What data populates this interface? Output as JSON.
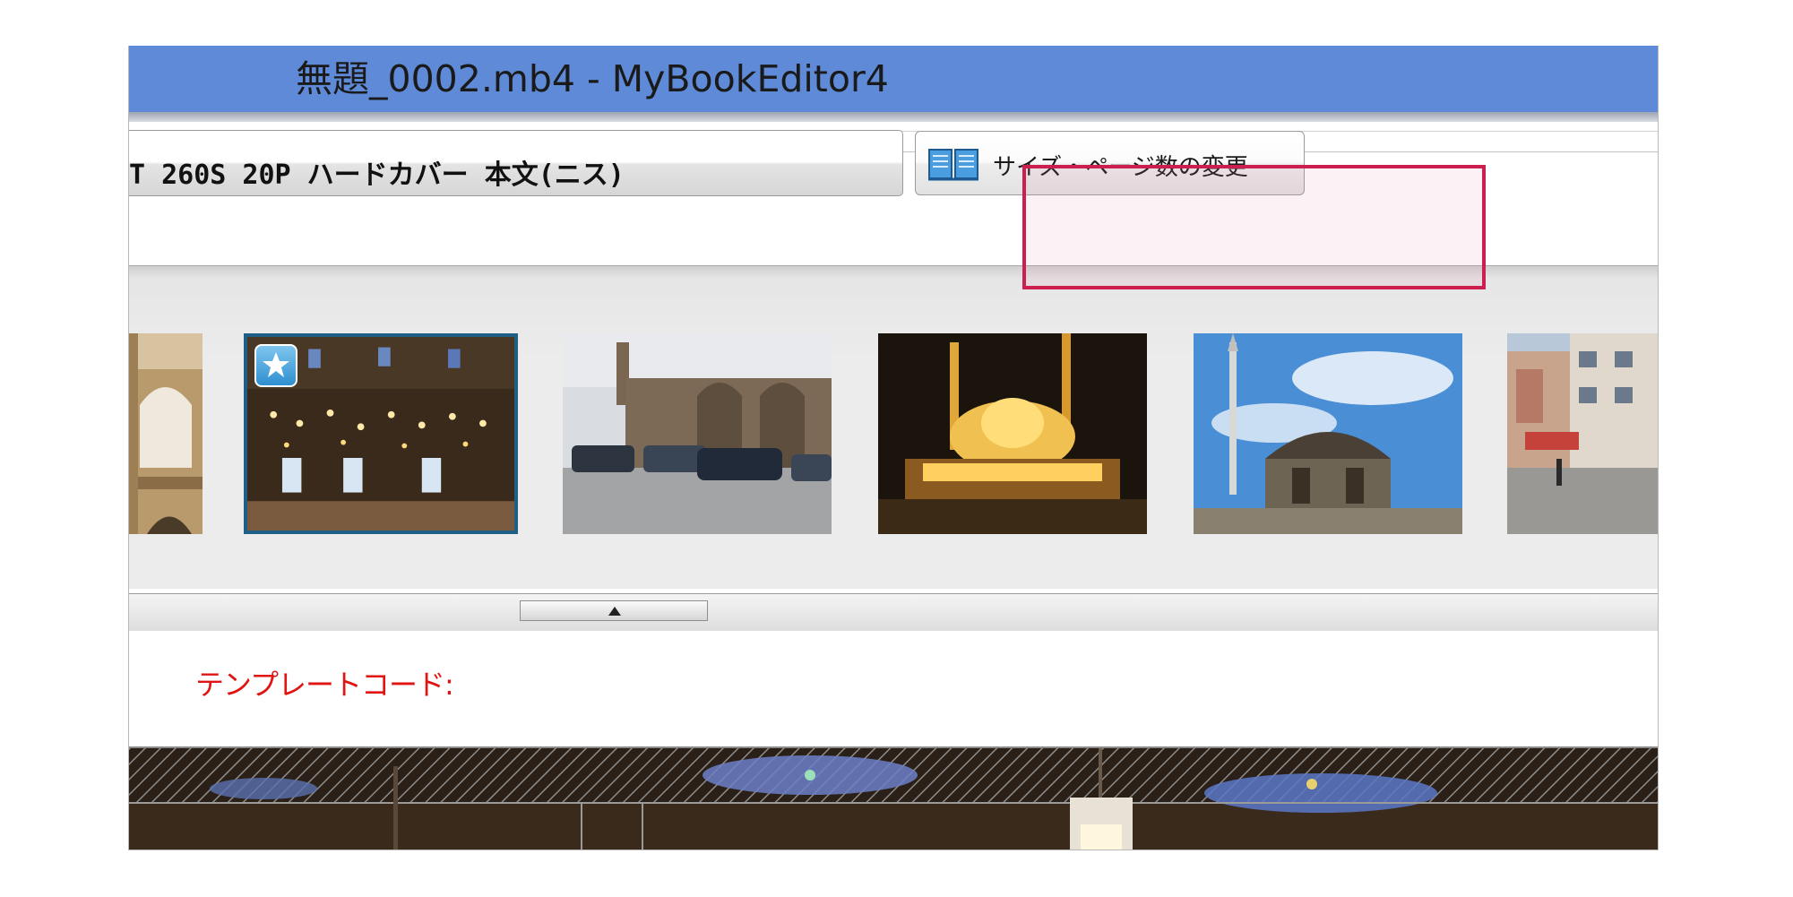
{
  "window": {
    "title": "無題_0002.mb4 - MyBookEditor4"
  },
  "toolbar": {
    "product_label": "T 260S 20P ハードカバー 本文(ニス)",
    "change_size_button": {
      "label": "サイズ・ページ数の変更",
      "icon": "book-icon"
    }
  },
  "photo_strip": {
    "thumbnails": [
      {
        "subject": "colosseum arches",
        "selected": false
      },
      {
        "subject": "mosque interior with lamps",
        "selected": true,
        "badge": "star-icon"
      },
      {
        "subject": "stone ruins with parked cars",
        "selected": false
      },
      {
        "subject": "illuminated mosque at night",
        "selected": false
      },
      {
        "subject": "ottoman fountain and minaret",
        "selected": false
      },
      {
        "subject": "city street with buildings",
        "selected": false
      }
    ],
    "collapse_handle_icon": "triangle-up-icon"
  },
  "template": {
    "code_label": "テンプレートコード:"
  },
  "colors": {
    "title_bar": "#5e8ad8",
    "highlight": "#cc1f4f",
    "selected_border": "#1f5e86",
    "template_label": "#e11414"
  }
}
